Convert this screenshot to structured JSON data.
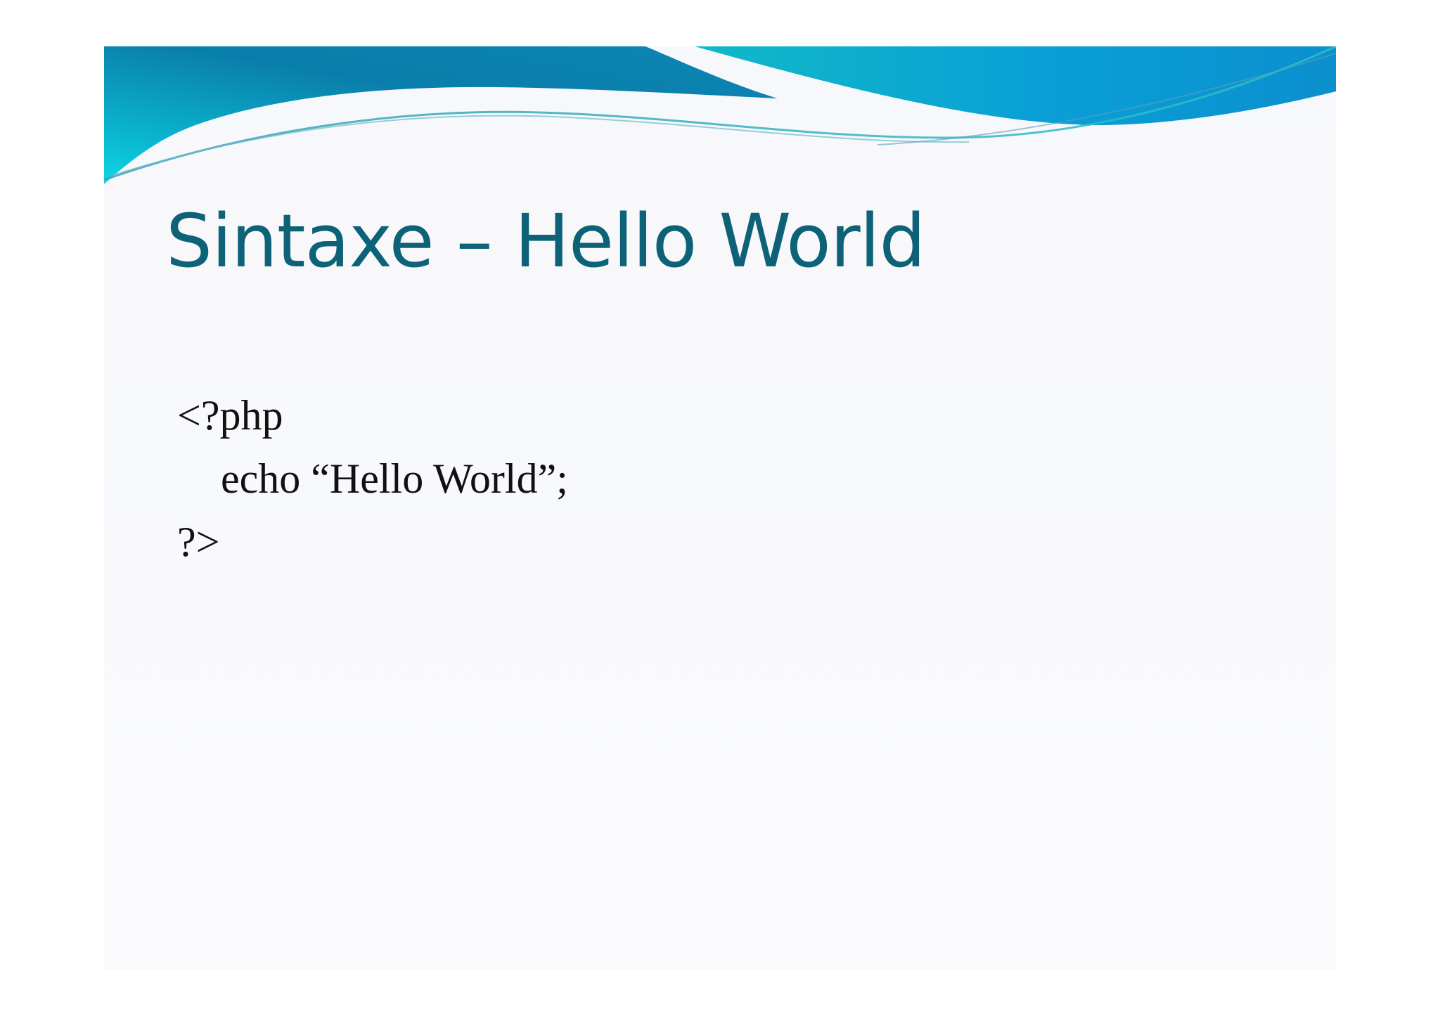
{
  "slide": {
    "title": "Sintaxe – Hello World",
    "code_lines": [
      "<?php",
      "echo “Hello World”;",
      "?>"
    ]
  },
  "colors": {
    "title": "#0d6278",
    "wave_dark": "#0a6f9a",
    "wave_light": "#12c6dc",
    "background": "#f8f9fb"
  }
}
